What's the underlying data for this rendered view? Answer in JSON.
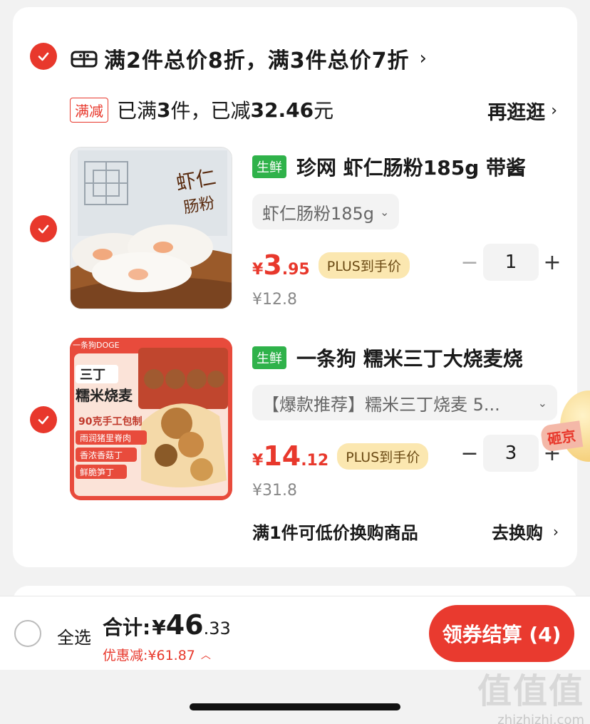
{
  "promo": {
    "title": "满2件总价8折，满3件总价7折",
    "chevron": "›",
    "tag": "满减",
    "status_prefix": "已满",
    "status_count": "3",
    "status_mid": "件，已减",
    "status_amount": "32.46",
    "status_suffix": "元",
    "shop_more": "再逛逛",
    "icon": "gift-icon"
  },
  "items": [
    {
      "fresh_tag": "生鲜",
      "title": "珍网 虾仁肠粉185g 带酱",
      "variant": "虾仁肠粉185g",
      "price_yen": "¥",
      "price_int": "3",
      "price_dec": ".95",
      "plus_tag": "PLUS到手价",
      "orig_price": "¥12.8",
      "qty": "1",
      "checked": true
    },
    {
      "fresh_tag": "生鲜",
      "title": "一条狗 糯米三丁大烧麦烧",
      "variant": "【爆款推荐】糯米三丁烧麦 5...",
      "price_yen": "¥",
      "price_int": "14",
      "price_dec": ".12",
      "plus_tag": "PLUS到手价",
      "orig_price": "¥31.8",
      "qty": "3",
      "checked": true,
      "thumb_text": {
        "brand": "一条狗DOGE",
        "line1": "三丁",
        "line2": "糯米烧麦",
        "line3": "90克手工包制",
        "b1": "雨润猪里脊肉",
        "b2": "香浓香菇丁",
        "b3": "鲜脆笋丁"
      }
    }
  ],
  "swap": {
    "label": "满1件可低价换购商品",
    "action": "去换购",
    "chevron": "›"
  },
  "smash": "砸京",
  "bottom": {
    "select_all": "全选",
    "total_label": "合计:",
    "total_yen": "¥",
    "total_int": "46",
    "total_dec": ".33",
    "discount": "优惠减:¥61.87",
    "checkout": "领券结算 (4)"
  },
  "watermark": {
    "big": "值值值",
    "small": "zhizhizhi.com"
  },
  "colors": {
    "accent": "#e8382c",
    "fresh": "#2fb24a",
    "plus_bg": "#fbe7b0"
  }
}
